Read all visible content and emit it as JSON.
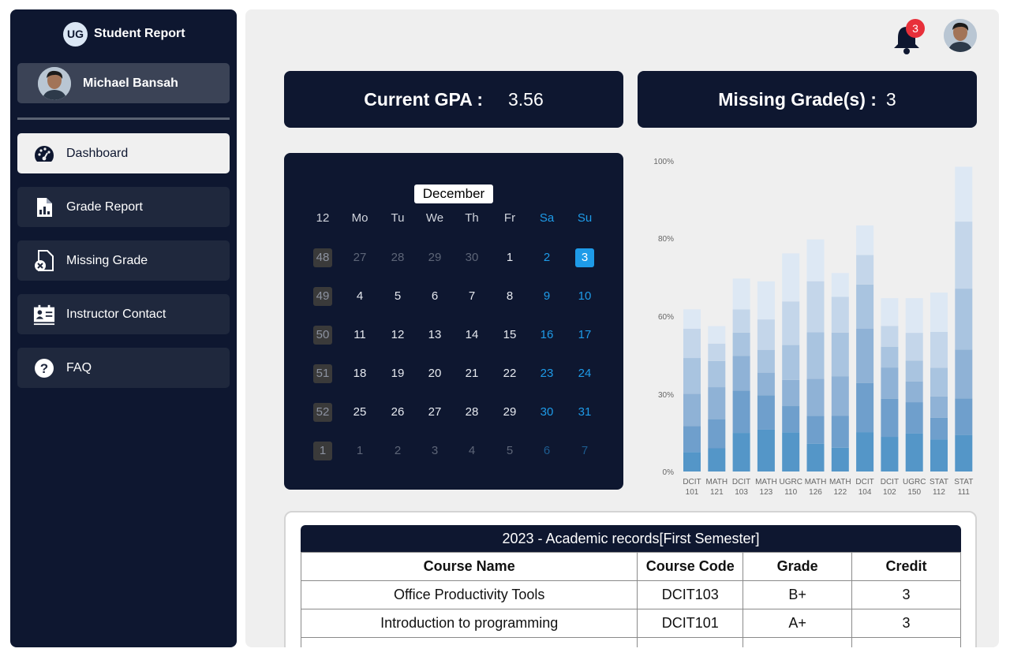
{
  "brand": {
    "logo": "UG",
    "title": "Student Report"
  },
  "profile": {
    "name": "Michael Bansah"
  },
  "nav": [
    {
      "label": "Dashboard",
      "icon": "dashboard-gauge-icon"
    },
    {
      "label": "Grade Report",
      "icon": "report-file-icon"
    },
    {
      "label": "Missing Grade",
      "icon": "missing-file-icon"
    },
    {
      "label": "Instructor Contact",
      "icon": "contact-card-icon"
    },
    {
      "label": "FAQ",
      "icon": "question-icon"
    }
  ],
  "header": {
    "notification_count": "3"
  },
  "stats": {
    "gpa_label": "Current GPA :",
    "gpa_value": "3.56",
    "missing_label": "Missing Grade(s) :",
    "missing_value": "3"
  },
  "calendar": {
    "month": "December",
    "headers": [
      "12",
      "Mo",
      "Tu",
      "We",
      "Th",
      "Fr",
      "Sa",
      "Su"
    ],
    "weeks": [
      {
        "week": "48",
        "days": [
          "27",
          "28",
          "29",
          "30",
          "1",
          "2",
          "3"
        ],
        "muted": [
          0,
          1,
          2,
          3
        ]
      },
      {
        "week": "49",
        "days": [
          "4",
          "5",
          "6",
          "7",
          "8",
          "9",
          "10"
        ],
        "muted": []
      },
      {
        "week": "50",
        "days": [
          "11",
          "12",
          "13",
          "14",
          "15",
          "16",
          "17"
        ],
        "muted": []
      },
      {
        "week": "51",
        "days": [
          "18",
          "19",
          "20",
          "21",
          "22",
          "23",
          "24"
        ],
        "muted": []
      },
      {
        "week": "52",
        "days": [
          "25",
          "26",
          "27",
          "28",
          "29",
          "30",
          "31"
        ],
        "muted": []
      },
      {
        "week": "1",
        "days": [
          "1",
          "2",
          "3",
          "4",
          "5",
          "6",
          "7"
        ],
        "muted": [
          0,
          1,
          2,
          3,
          4,
          5,
          6
        ]
      }
    ],
    "today": "3"
  },
  "chart_data": {
    "type": "bar",
    "stacked": true,
    "y_ticks": [
      "0%",
      "30%",
      "60%",
      "80%",
      "100%"
    ],
    "categories": [
      "DCIT 101",
      "MATH 121",
      "DCIT 103",
      "MATH 123",
      "UGRC 110",
      "MATH 126",
      "MATH 122",
      "DCIT 104",
      "DCIT 102",
      "UGRC 150",
      "STAT 112",
      "STAT 111"
    ],
    "totals": [
      58,
      52,
      69,
      68,
      78,
      83,
      71,
      88,
      62,
      62,
      64,
      109
    ],
    "colors": [
      "#5496c8",
      "#6f9fcc",
      "#8fb2d6",
      "#a9c4e0",
      "#c4d6ea",
      "#dde8f4"
    ]
  },
  "table": {
    "title": "2023 - Academic records[First Semester]",
    "headers": [
      "Course Name",
      "Course Code",
      "Grade",
      "Credit"
    ],
    "rows": [
      [
        "Office Productivity Tools",
        "DCIT103",
        "B+",
        "3"
      ],
      [
        "Introduction to programming",
        "DCIT101",
        "A+",
        "3"
      ],
      [
        "",
        "",
        "",
        ""
      ]
    ]
  }
}
